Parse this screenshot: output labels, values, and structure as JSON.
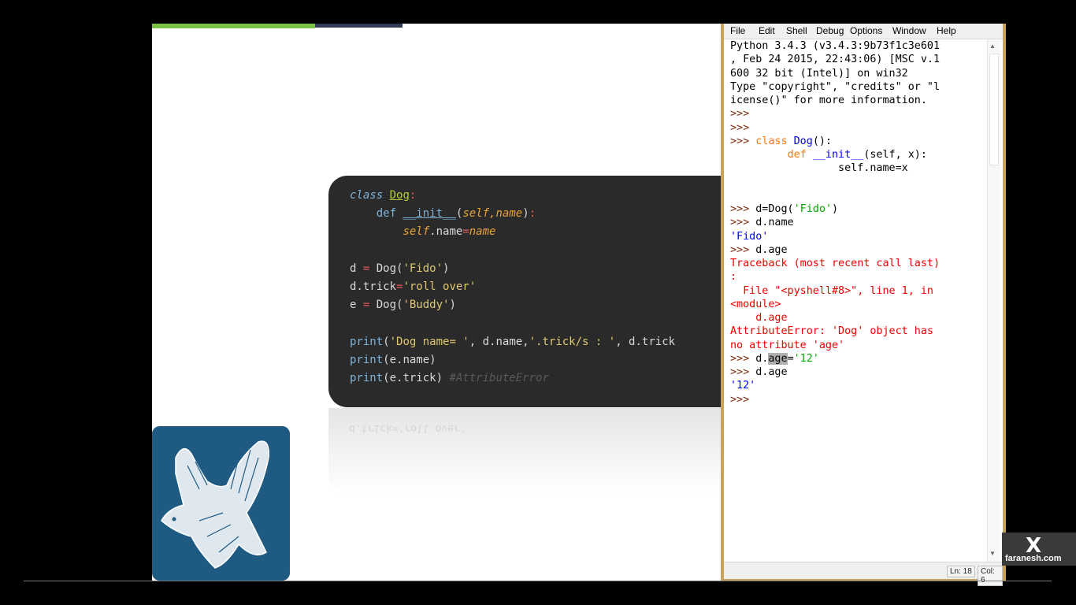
{
  "slide": {
    "code_lines": [
      "class Dog:",
      "    def __init__(self,name):",
      "        self.name=name",
      "",
      "d = Dog('Fido')",
      "d.trick='roll over'",
      "e = Dog('Buddy')",
      "",
      "print('Dog name= ', d.name,'.trick/s : ', d.trick",
      "print(e.name)",
      "print(e.trick) #AttributeError"
    ],
    "reflection_text": "d.trick='roll over'"
  },
  "shell": {
    "menu": [
      "File",
      "Edit",
      "Shell",
      "Debug",
      "Options",
      "Window",
      "Help"
    ],
    "lines": [
      "Python 3.4.3 (v3.4.3:9b73f1c3e601",
      ", Feb 24 2015, 22:43:06) [MSC v.1",
      "600 32 bit (Intel)] on win32",
      "Type \"copyright\", \"credits\" or \"l",
      "icense()\" for more information.",
      ">>>",
      ">>>",
      ">>> class Dog():",
      "         def __init__(self, x):",
      "                 self.name=x",
      "",
      "",
      ">>> d=Dog('Fido')",
      ">>> d.name",
      "'Fido'",
      ">>> d.age",
      "Traceback (most recent call last)",
      ":",
      "  File \"<pyshell#8>\", line 1, in",
      "<module>",
      "    d.age",
      "AttributeError: 'Dog' object has",
      "no attribute 'age'",
      ">>> d.age='12'",
      ">>> d.age",
      "'12'",
      ">>>"
    ],
    "status": {
      "line": "Ln: 18",
      "col": "Col: 6"
    }
  },
  "watermark": {
    "icon": "X",
    "text": "faranesh.com"
  },
  "colors": {
    "shell_border": "#c8a35a",
    "code_card_bg": "#2a2a2a",
    "logo_bg": "#1e5a82"
  }
}
